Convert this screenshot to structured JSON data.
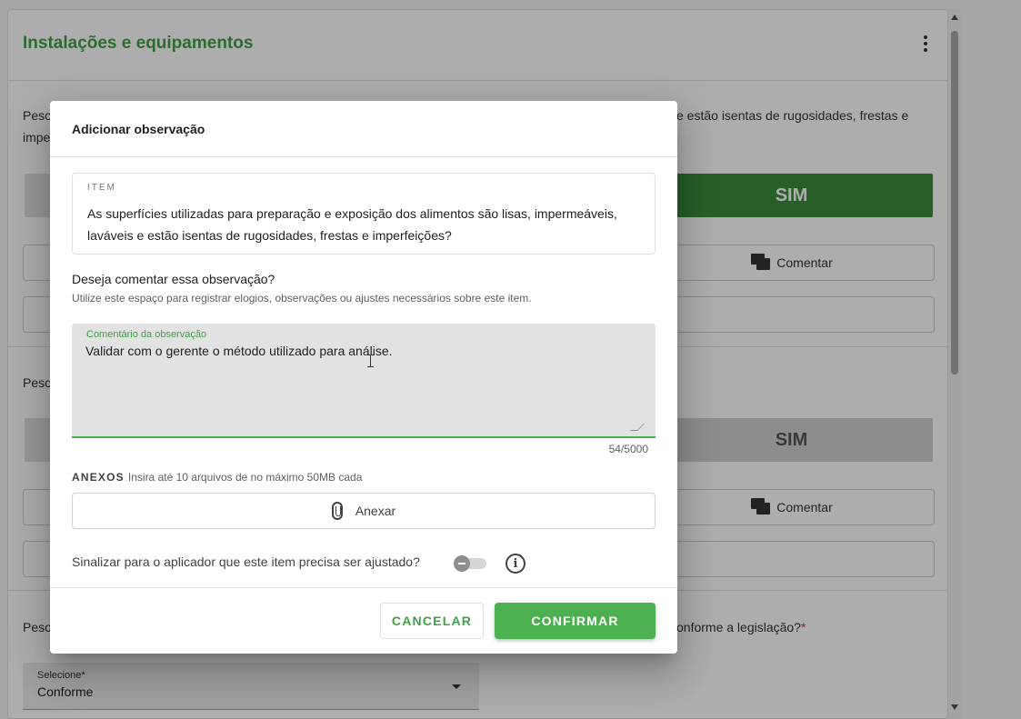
{
  "background": {
    "card_title": "Instalações e equipamentos",
    "q1_left": "Peso",
    "q1_left2": "impe",
    "q1_right": "e estão isentas de rugosidades, frestas e",
    "q2_left": "Peso",
    "q3_left": "Peso",
    "q3_right": "onforme a legislação?",
    "required_mark": "*",
    "sim_label": "SIM",
    "comment_label": "Comentar",
    "select": {
      "label": "Selecione*",
      "value": "Conforme"
    }
  },
  "dialog": {
    "title": "Adicionar observação",
    "item_label": "ITEM",
    "item_text": "As superfícies utilizadas para preparação e exposição dos alimentos são lisas, impermeáveis, laváveis e estão isentas de rugosidades, frestas e imperfeições?",
    "question": "Deseja comentar essa observação?",
    "hint": "Utilize este espaço para registrar elogios, observações ou ajustes necessários sobre este item.",
    "comment_label": "Comentário da observação",
    "comment_value": "Validar com o gerente o método utilizado para análise.",
    "counter": "54/5000",
    "anexos_title": "ANEXOS",
    "anexos_hint": "Insira até 10 arquivos de no máximo 50MB cada",
    "attach_label": "Anexar",
    "flag_text": "Sinalizar para o aplicador que este item precisa ser ajustado?",
    "cancel_label": "CANCELAR",
    "confirm_label": "CONFIRMAR"
  },
  "colors": {
    "accent": "#4caf50",
    "title_green": "#43a047",
    "sim_green": "#388e3c"
  },
  "icons": [
    "kebab-menu-icon",
    "comment-icon",
    "paperclip-icon",
    "info-icon",
    "chevron-down-icon",
    "text-cursor-icon"
  ]
}
